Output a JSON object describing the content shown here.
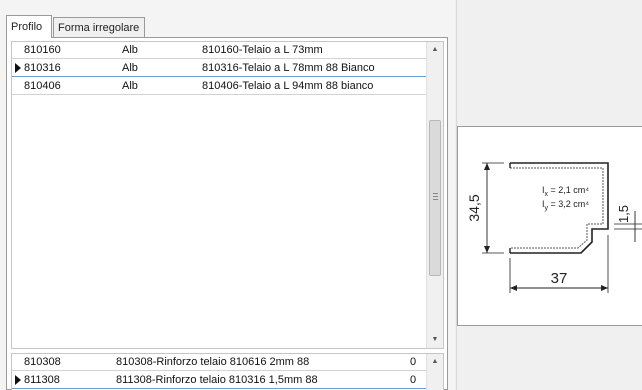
{
  "tabs": [
    {
      "label": "Profilo",
      "active": true
    },
    {
      "label": "Forma irregolare",
      "active": false
    }
  ],
  "profiles_grid": {
    "rows": [
      {
        "code": "810160",
        "color": "Alb",
        "description": "810160-Telaio a L 73mm",
        "current": false
      },
      {
        "code": "810316",
        "color": "Alb",
        "description": "810316-Telaio a L 78mm 88 Bianco",
        "current": true
      },
      {
        "code": "810406",
        "color": "Alb",
        "description": "810406-Telaio a L 94mm 88 bianco",
        "current": false
      }
    ]
  },
  "reinforcements_grid": {
    "rows": [
      {
        "code": "810308",
        "description": "810308-Rinforzo telaio 810616  2mm 88",
        "quantity": "0",
        "current": false
      },
      {
        "code": "811308",
        "description": "811308-Rinforzo telaio 810316  1,5mm 88",
        "quantity": "0",
        "current": true
      }
    ]
  },
  "section_drawing": {
    "height_dim": "34,5",
    "width_dim": "37",
    "thickness_dim": "1,5",
    "ix_label": "I",
    "ix_sub": "x",
    "ix_value": " = 2,1 cm⁴",
    "iy_label": "I",
    "iy_sub": "y",
    "iy_value": " = 3,2 cm⁴"
  },
  "icons": {
    "row_indicator": "row-indicator-icon",
    "scroll_up": "scroll-up-arrow-icon",
    "scroll_down": "scroll-down-arrow-icon"
  }
}
